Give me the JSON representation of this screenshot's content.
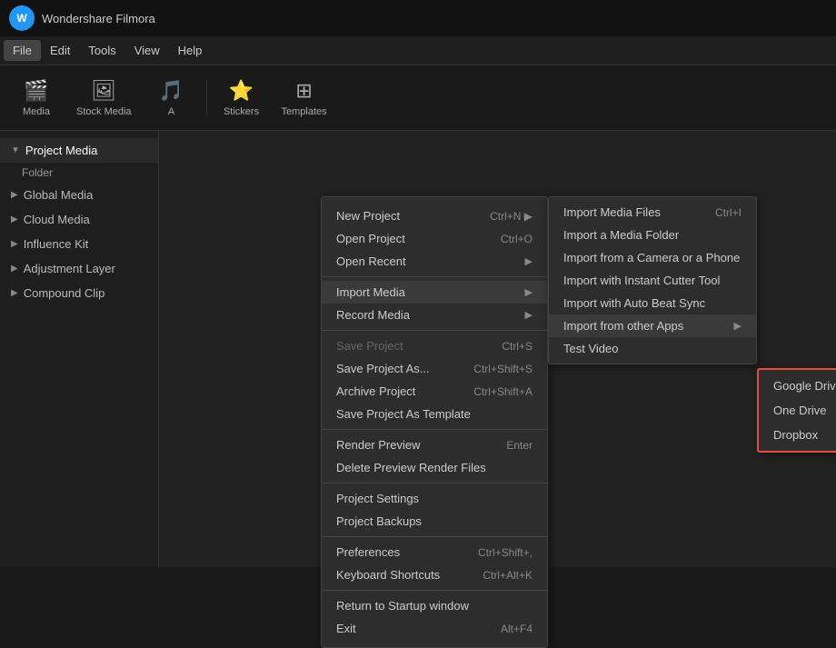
{
  "app": {
    "logo": "W",
    "name": "Wondershare Filmora"
  },
  "menubar": {
    "items": [
      {
        "label": "File",
        "id": "file",
        "active": true
      },
      {
        "label": "Edit",
        "id": "edit"
      },
      {
        "label": "Tools",
        "id": "tools"
      },
      {
        "label": "View",
        "id": "view"
      },
      {
        "label": "Help",
        "id": "help"
      }
    ]
  },
  "toolbar": {
    "buttons": [
      {
        "label": "Media",
        "icon": "🎬",
        "id": "media"
      },
      {
        "label": "Stock Media",
        "icon": "🖼",
        "id": "stock-media"
      },
      {
        "label": "Audio",
        "icon": "🎵",
        "id": "audio"
      },
      {
        "label": "Stickers",
        "icon": "⭐",
        "id": "stickers"
      },
      {
        "label": "Templates",
        "icon": "⊞",
        "id": "templates"
      }
    ]
  },
  "sidebar": {
    "items": [
      {
        "label": "Project Media",
        "id": "project-media",
        "active": true,
        "icon": "▼"
      },
      {
        "label": "Folder",
        "id": "folder",
        "sub": true
      },
      {
        "label": "Global Media",
        "id": "global-media",
        "icon": "▶"
      },
      {
        "label": "Cloud Media",
        "id": "cloud-media",
        "icon": "▶"
      },
      {
        "label": "Influence Kit",
        "id": "influence-kit",
        "icon": "▶"
      },
      {
        "label": "Adjustment Layer",
        "id": "adjustment-layer",
        "icon": "▶"
      },
      {
        "label": "Compound Clip",
        "id": "compound-clip",
        "icon": "▶"
      }
    ]
  },
  "file_menu": {
    "sections": [
      {
        "items": [
          {
            "label": "New Project",
            "shortcut": "Ctrl+N",
            "has_submenu": true
          },
          {
            "label": "Open Project",
            "shortcut": "Ctrl+O"
          },
          {
            "label": "Open Recent",
            "has_submenu": true
          }
        ]
      },
      {
        "items": [
          {
            "label": "Import Media",
            "has_submenu": true,
            "active": true
          },
          {
            "label": "Record Media",
            "has_submenu": true
          }
        ]
      },
      {
        "items": [
          {
            "label": "Save Project",
            "shortcut": "Ctrl+S",
            "disabled": true
          },
          {
            "label": "Save Project As...",
            "shortcut": "Ctrl+Shift+S"
          },
          {
            "label": "Archive Project",
            "shortcut": "Ctrl+Shift+A"
          },
          {
            "label": "Save Project As Template"
          }
        ]
      },
      {
        "items": [
          {
            "label": "Render Preview",
            "shortcut": "Enter"
          },
          {
            "label": "Delete Preview Render Files"
          }
        ]
      },
      {
        "items": [
          {
            "label": "Project Settings"
          },
          {
            "label": "Project Backups"
          }
        ]
      },
      {
        "items": [
          {
            "label": "Preferences",
            "shortcut": "Ctrl+Shift+,"
          },
          {
            "label": "Keyboard Shortcuts",
            "shortcut": "Ctrl+Alt+K"
          }
        ]
      },
      {
        "items": [
          {
            "label": "Return to Startup window"
          },
          {
            "label": "Exit",
            "shortcut": "Alt+F4"
          }
        ]
      }
    ]
  },
  "import_submenu": {
    "items": [
      {
        "label": "Import Media Files",
        "shortcut": "Ctrl+I"
      },
      {
        "label": "Import a Media Folder"
      },
      {
        "label": "Import from a Camera or a Phone"
      },
      {
        "label": "Import with Instant Cutter Tool"
      },
      {
        "label": "Import with Auto Beat Sync"
      },
      {
        "label": "Import from other Apps",
        "has_submenu": true,
        "active": true
      },
      {
        "label": "Test Video"
      }
    ]
  },
  "other_apps_submenu": {
    "items": [
      {
        "label": "Google Drive"
      },
      {
        "label": "One Drive"
      },
      {
        "label": "Dropbox"
      }
    ]
  },
  "content": {
    "filter_icon": "⊟",
    "more_icon": "⋯"
  }
}
